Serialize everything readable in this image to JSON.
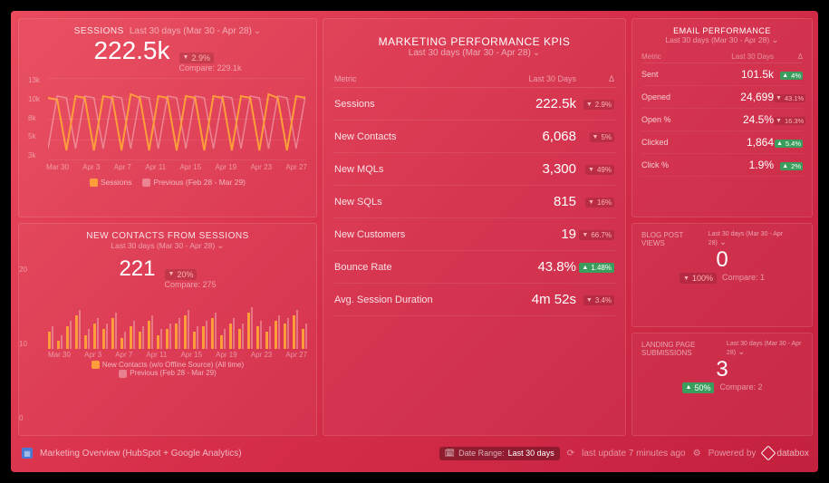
{
  "sessions": {
    "title": "SESSIONS",
    "range": "Last 30 days (Mar 30 - Apr 28)",
    "value": "222.5k",
    "delta": "2.9%",
    "compare": "Compare: 229.1k",
    "legend_current": "Sessions",
    "legend_prev": "Previous (Feb 28 - Mar 29)"
  },
  "kpis": {
    "title": "MARKETING PERFORMANCE KPIS",
    "range": "Last 30 days (Mar 30 - Apr 28)",
    "head_metric": "Metric",
    "head_value": "Last 30 Days",
    "head_delta": "Δ",
    "rows": [
      {
        "metric": "Sessions",
        "value": "222.5k",
        "delta": "2.9%",
        "dir": "down"
      },
      {
        "metric": "New Contacts",
        "value": "6,068",
        "delta": "5%",
        "dir": "down"
      },
      {
        "metric": "New MQLs",
        "value": "3,300",
        "delta": "49%",
        "dir": "down"
      },
      {
        "metric": "New SQLs",
        "value": "815",
        "delta": "16%",
        "dir": "down"
      },
      {
        "metric": "New Customers",
        "value": "19",
        "delta": "66.7%",
        "dir": "down"
      },
      {
        "metric": "Bounce Rate",
        "value": "43.8%",
        "delta": "1.48%",
        "dir": "up"
      },
      {
        "metric": "Avg. Session Duration",
        "value": "4m 52s",
        "delta": "3.4%",
        "dir": "down"
      }
    ]
  },
  "email": {
    "title": "EMAIL PERFORMANCE",
    "range": "Last 30 days (Mar 30 - Apr 28)",
    "head_metric": "Metric",
    "head_value": "Last 30 Days",
    "head_delta": "Δ",
    "rows": [
      {
        "metric": "Sent",
        "value": "101.5k",
        "delta": "4%",
        "dir": "up"
      },
      {
        "metric": "Opened",
        "value": "24,699",
        "delta": "43.1%",
        "dir": "down"
      },
      {
        "metric": "Open %",
        "value": "24.5%",
        "delta": "16.3%",
        "dir": "down"
      },
      {
        "metric": "Clicked",
        "value": "1,864",
        "delta": "5.4%",
        "dir": "up"
      },
      {
        "metric": "Click %",
        "value": "1.9%",
        "delta": "2%",
        "dir": "up"
      }
    ]
  },
  "contacts": {
    "title": "NEW CONTACTS FROM SESSIONS",
    "range": "Last 30 days (Mar 30 - Apr 28)",
    "value": "221",
    "delta": "20%",
    "compare": "Compare: 275",
    "legend_current": "New Contacts (w/o Offline Source) (All time)",
    "legend_prev": "Previous (Feb 28 - Mar 29)"
  },
  "blog": {
    "title": "BLOG POST VIEWS",
    "range": "Last 30 days (Mar 30 - Apr 28)",
    "value": "0",
    "delta": "100%",
    "compare": "Compare: 1"
  },
  "landing": {
    "title": "LANDING PAGE SUBMISSIONS",
    "range": "Last 30 days (Mar 30 - Apr 28)",
    "value": "3",
    "delta": "50%",
    "compare": "Compare: 2"
  },
  "footer": {
    "name": "Marketing Overview (HubSpot + Google Analytics)",
    "range_label": "Date Range:",
    "range_value": "Last 30 days",
    "update": "last update 7 minutes ago",
    "powered": "Powered by",
    "brand": "databox"
  },
  "chart_data": [
    {
      "type": "line",
      "title": "Sessions",
      "xlabel": "",
      "ylabel": "",
      "ylim": [
        3000,
        13000
      ],
      "y_ticks": [
        "13k",
        "10k",
        "8k",
        "5k",
        "3k"
      ],
      "x": [
        "Mar 30",
        "Apr 3",
        "Apr 7",
        "Apr 11",
        "Apr 15",
        "Apr 19",
        "Apr 23",
        "Apr 27"
      ],
      "series": [
        {
          "name": "Sessions",
          "color": "#ff9d3a",
          "values": [
            9800,
            9500,
            4200,
            9700,
            9400,
            4100,
            9800,
            9600,
            4200,
            9900,
            9500,
            4300,
            9700,
            9500,
            4200,
            9800,
            9600,
            4100,
            9700,
            9500,
            4300,
            9800,
            9700,
            4200,
            9900,
            9600,
            4300,
            9800,
            9700
          ]
        },
        {
          "name": "Previous (Feb 28 - Mar 29)",
          "color": "rgba(255,255,255,0.35)",
          "values": [
            9200,
            9400,
            4500,
            9500,
            9300,
            4300,
            9600,
            9400,
            4400,
            9700,
            9300,
            4500,
            9500,
            9200,
            4300,
            9600,
            9400,
            4200,
            9500,
            9300,
            4400,
            9600,
            9500,
            4300,
            9700,
            9400,
            4500,
            9600,
            9500
          ]
        }
      ]
    },
    {
      "type": "bar",
      "title": "New Contacts from Sessions",
      "xlabel": "",
      "ylabel": "",
      "ylim": [
        0,
        20
      ],
      "y_ticks": [
        "20",
        "10",
        "0"
      ],
      "x": [
        "Mar 30",
        "Apr 3",
        "Apr 7",
        "Apr 11",
        "Apr 15",
        "Apr 19",
        "Apr 23",
        "Apr 27"
      ],
      "series": [
        {
          "name": "New Contacts (w/o Offline Source) (All time)",
          "color": "#ff9d3a",
          "values": [
            6,
            3,
            8,
            12,
            5,
            9,
            7,
            11,
            4,
            8,
            6,
            10,
            5,
            7,
            9,
            12,
            6,
            8,
            11,
            5,
            9,
            7,
            13,
            8,
            6,
            10,
            9,
            12,
            7
          ]
        },
        {
          "name": "Previous (Feb 28 - Mar 29)",
          "color": "rgba(255,255,255,0.3)",
          "values": [
            8,
            5,
            10,
            14,
            7,
            11,
            9,
            13,
            6,
            10,
            8,
            12,
            7,
            9,
            11,
            14,
            8,
            10,
            13,
            7,
            11,
            9,
            15,
            10,
            8,
            12,
            11,
            14,
            9
          ]
        }
      ]
    }
  ]
}
